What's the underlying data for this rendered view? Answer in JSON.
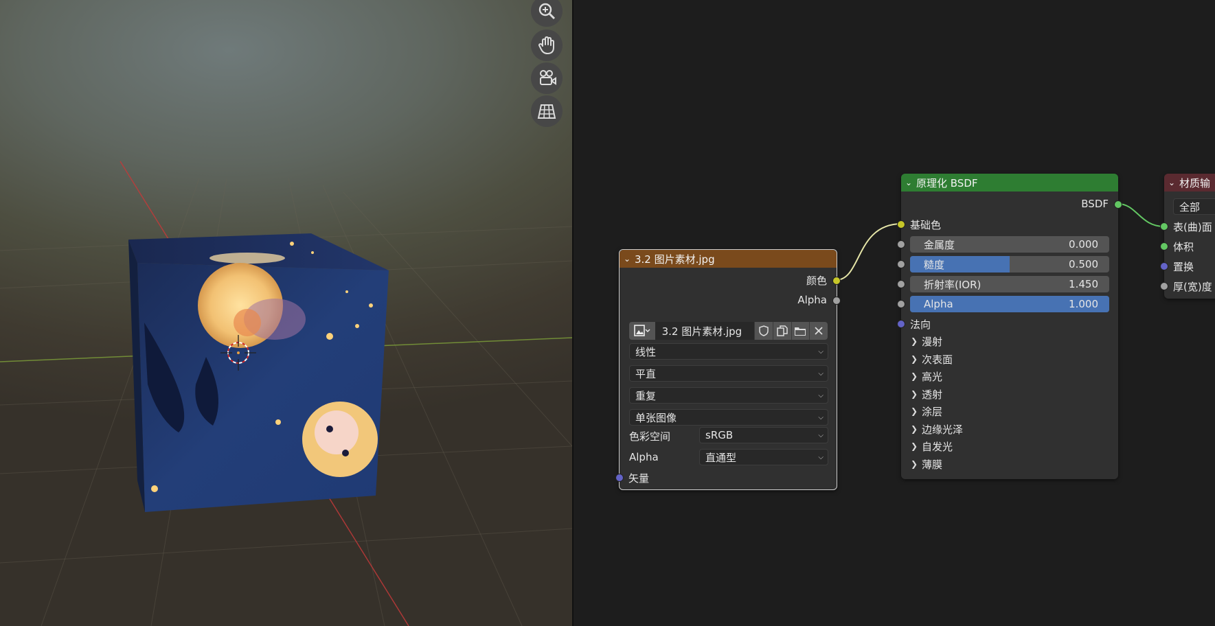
{
  "viewport": {
    "nav_buttons": [
      {
        "icon": "zoom-icon"
      },
      {
        "icon": "hand-pan-icon"
      },
      {
        "icon": "camera-view-icon"
      },
      {
        "icon": "grid-ortho-icon"
      }
    ]
  },
  "image_node": {
    "title": "3.2 图片素材.jpg",
    "header_color": "#7a4a1c",
    "outputs": [
      "颜色",
      "Alpha"
    ],
    "image_name": "3.2 图片素材.jpg",
    "interpolation": "线性",
    "projection": "平直",
    "extension": "重复",
    "source": "单张图像",
    "color_space_label": "色彩空间",
    "color_space_value": "sRGB",
    "alpha_label": "Alpha",
    "alpha_value": "直通型",
    "input_vector": "矢量"
  },
  "bsdf_node": {
    "title": "原理化 BSDF",
    "header_color": "#2e7d32",
    "output": "BSDF",
    "base_color": "基础色",
    "fields": [
      {
        "label": "金属度",
        "value": "0.000",
        "fraction": 0.0
      },
      {
        "label": "糙度",
        "value": "0.500",
        "fraction": 0.5
      },
      {
        "label": "折射率(IOR)",
        "value": "1.450",
        "fraction": 0.0
      },
      {
        "label": "Alpha",
        "value": "1.000",
        "fraction": 1.0
      }
    ],
    "normal": "法向",
    "panels": [
      "漫射",
      "次表面",
      "高光",
      "透射",
      "涂层",
      "边缘光泽",
      "自发光",
      "薄膜"
    ]
  },
  "output_node": {
    "title": "材质输",
    "header_color": "#5a2a30",
    "target": "全部",
    "inputs": [
      "表(曲)面",
      "体积",
      "置换",
      "厚(宽)度"
    ]
  },
  "colors": {
    "socket_color": "#c7c729",
    "socket_float": "#a1a1a1",
    "socket_vector": "#6363c7",
    "socket_shader": "#63c763",
    "accent": "#4772b3"
  }
}
